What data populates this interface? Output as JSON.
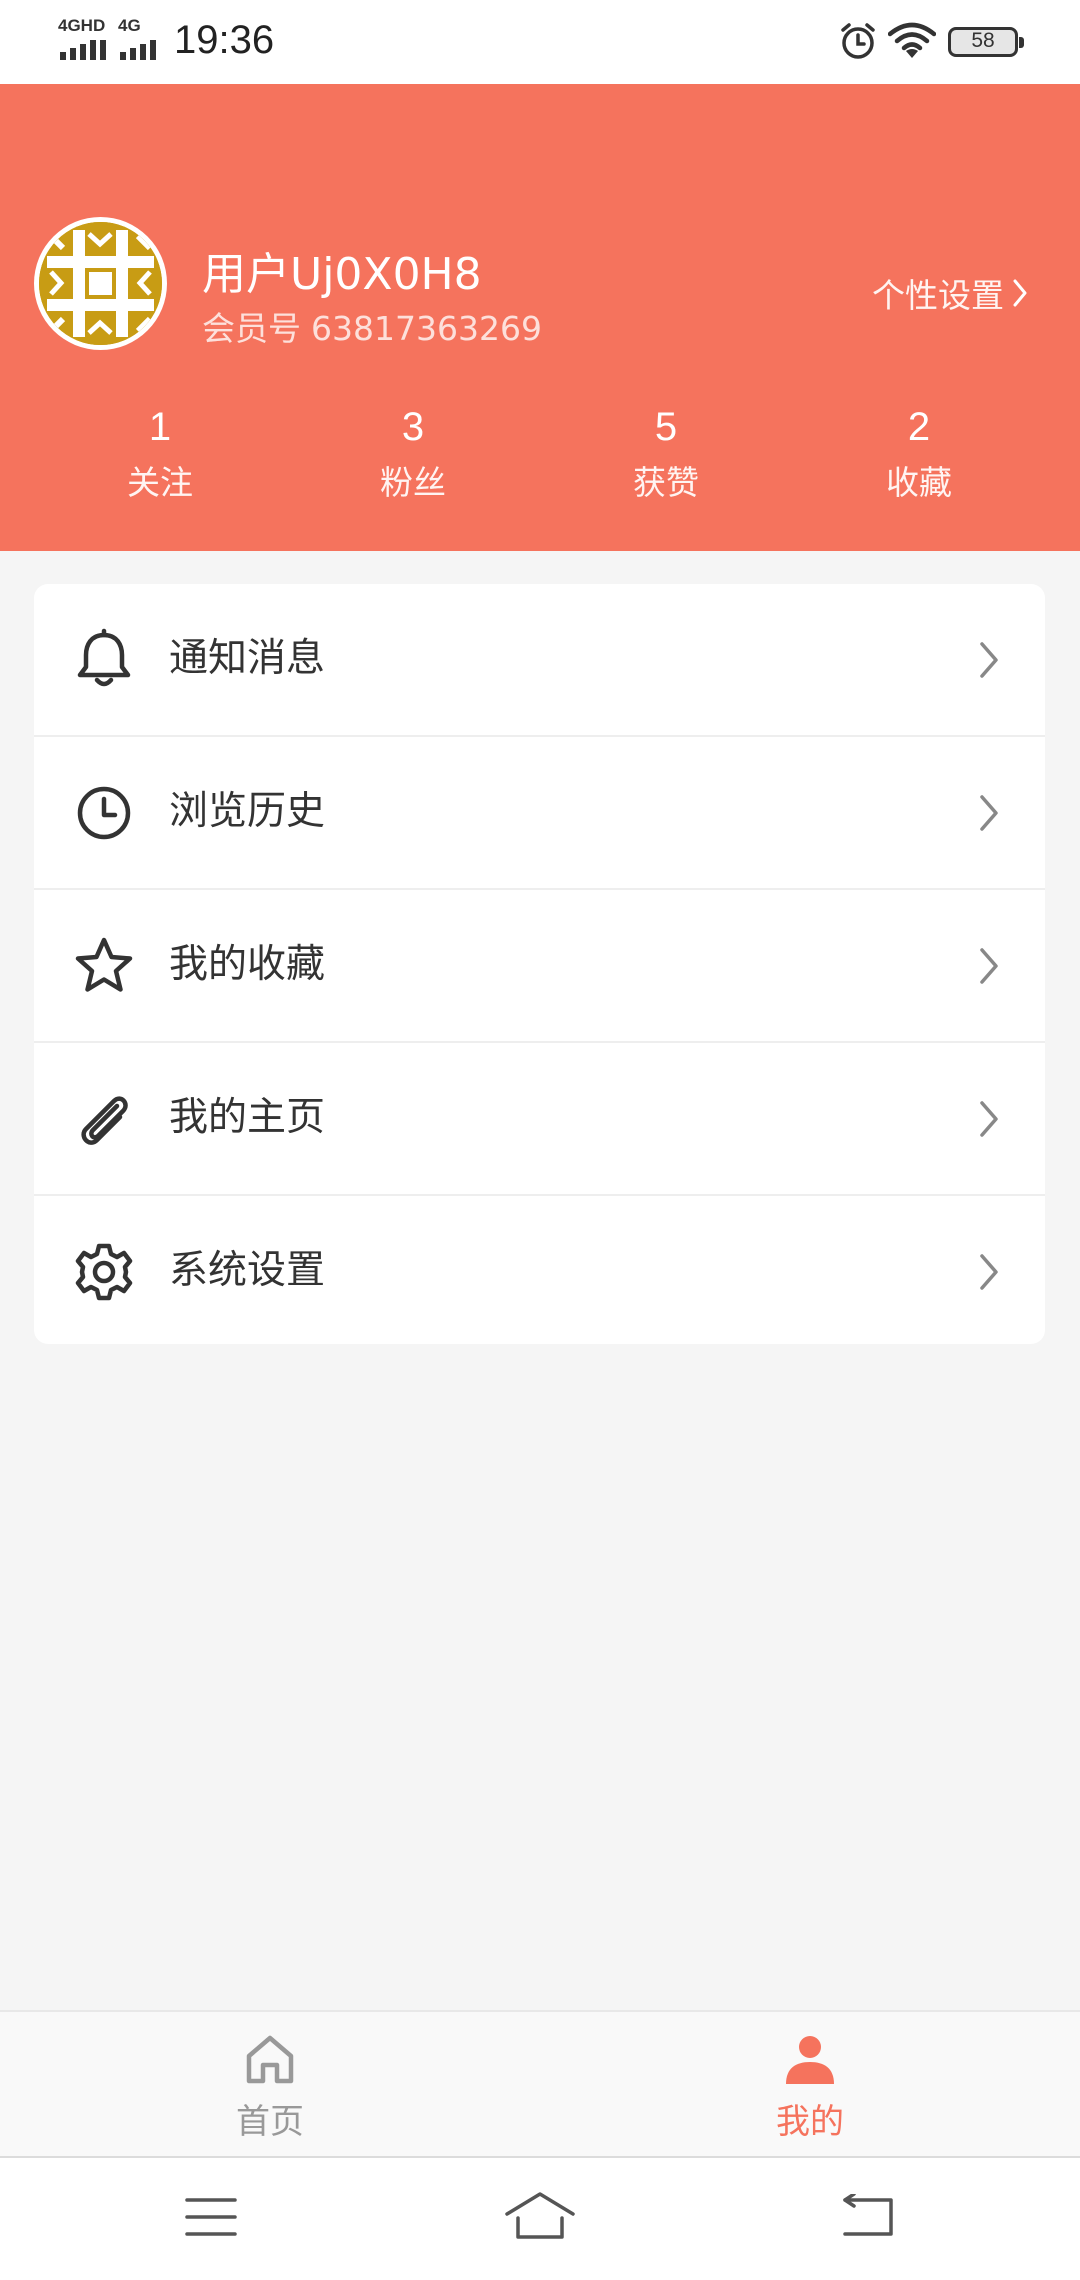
{
  "status_bar": {
    "network_1": "4GHD",
    "network_2": "4G",
    "time": "19:36",
    "battery": "58",
    "icons": [
      "alarm-icon",
      "wifi-icon",
      "battery-icon"
    ]
  },
  "profile": {
    "username": "用户Uj0X0H8",
    "member_label": "会员号",
    "member_id": "63817363269",
    "settings_link": "个性设置",
    "header_color": "#f5735d"
  },
  "stats": [
    {
      "value": "1",
      "label": "关注"
    },
    {
      "value": "3",
      "label": "粉丝"
    },
    {
      "value": "5",
      "label": "获赞"
    },
    {
      "value": "2",
      "label": "收藏"
    }
  ],
  "menu": [
    {
      "label": "通知消息",
      "icon": "bell-icon"
    },
    {
      "label": "浏览历史",
      "icon": "clock-icon"
    },
    {
      "label": "我的收藏",
      "icon": "star-icon"
    },
    {
      "label": "我的主页",
      "icon": "paperclip-icon"
    },
    {
      "label": "系统设置",
      "icon": "gear-icon"
    }
  ],
  "tabbar": {
    "tabs": [
      {
        "label": "首页",
        "icon": "home-icon",
        "active": false
      },
      {
        "label": "我的",
        "icon": "person-icon",
        "active": true
      }
    ],
    "active_color": "#f5735d",
    "inactive_color": "#999999"
  },
  "system_nav": [
    "menu-icon",
    "home-outline-icon",
    "back-icon"
  ]
}
